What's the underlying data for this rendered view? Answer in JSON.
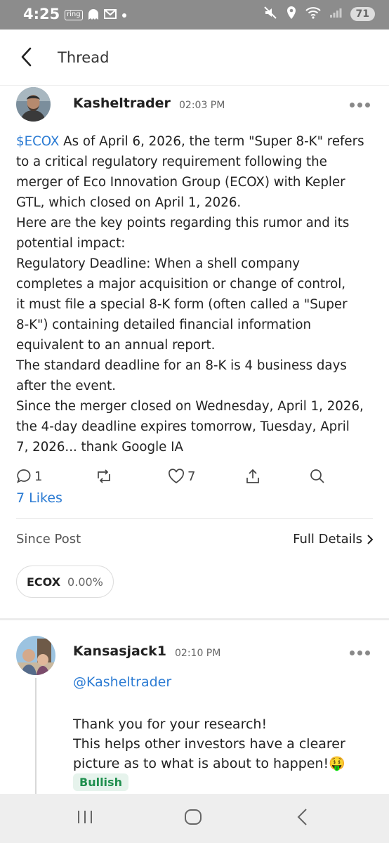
{
  "status_bar": {
    "time": "4:25",
    "left_icons": [
      "ring-icon",
      "ghost-icon",
      "mail-icon",
      "dot-icon"
    ],
    "ring_label": "ring",
    "battery": "71"
  },
  "header": {
    "title": "Thread"
  },
  "post": {
    "author": "Kasheltrader",
    "time": "02:03 PM",
    "ticker": "$ECOX",
    "first_line_rest": " As of April 6, 2026, the term \"Super 8-K\" refers",
    "lines": [
      "to a critical regulatory requirement following the",
      "merger of Eco Innovation Group (ECOX) with Kepler",
      "GTL, which closed on April 1, 2026.",
      "Here are the key points regarding this rumor and its",
      "potential impact:",
      "Regulatory Deadline: When a shell company",
      "completes a major acquisition or change of control,",
      "it must file a special 8-K form (often called a \"Super",
      "8-K\") containing detailed financial information",
      "equivalent to an annual report.",
      "The standard deadline for an 8-K is 4 business days",
      "after the event.",
      "Since the merger closed on Wednesday, April 1, 2026,",
      "the 4-day deadline expires tomorrow, Tuesday, April",
      "7, 2026... thank Google IA"
    ],
    "replies_count": "1",
    "likes_count": "7",
    "likes_text": "7 Likes",
    "since_post_label": "Since Post",
    "full_details_label": "Full Details",
    "chip_symbol": "ECOX",
    "chip_change": "0.00%"
  },
  "reply": {
    "author": "Kansasjack1",
    "time": "02:10 PM",
    "mention": "@Kasheltrader",
    "lines": [
      "Thank you for your research!",
      "This helps other investors have a clearer",
      "picture as to what is about to happen!🤑"
    ],
    "sentiment": "Bullish"
  },
  "colors": {
    "link": "#2b7bd3",
    "bullish": "#1f8f4e",
    "status_bar": "#8c8c8c"
  }
}
